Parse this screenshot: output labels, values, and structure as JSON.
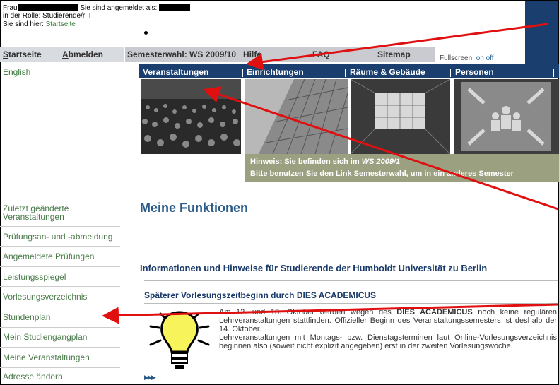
{
  "login": {
    "frau": "Frau",
    "logged_in_as": "Sie sind angemeldet als:",
    "role": "in der Rolle: Studierende/r",
    "role_suffix": "I",
    "breadcrumb_label": "Sie sind hier:",
    "breadcrumb_link": "Startseite"
  },
  "topnav": {
    "start": "Startseite",
    "logout": "Abmelden",
    "semester": "Semesterwahl: WS 2009/10",
    "help": "Hilfe",
    "faq": "FAQ",
    "sitemap": "Sitemap",
    "fullscreen_label": "Fullscreen:",
    "fullscreen_on": "on",
    "fullscreen_off": "off"
  },
  "sidebar": {
    "language": "English",
    "items": [
      {
        "label": "Zuletzt geänderte Veranstaltungen"
      },
      {
        "label": "Prüfungsan- und -abmeldung"
      },
      {
        "label": "Angemeldete Prüfungen"
      },
      {
        "label": "Leistungsspiegel"
      },
      {
        "label": "Vorlesungsverzeichnis"
      },
      {
        "label": "Stundenplan"
      },
      {
        "label": "Mein Studiengangplan"
      },
      {
        "label": "Meine Veranstaltungen"
      },
      {
        "label": "Adresse ändern"
      }
    ]
  },
  "categories": [
    {
      "label": "Veranstaltungen"
    },
    {
      "label": "Einrichtungen"
    },
    {
      "label": "Räume & Gebäude"
    },
    {
      "label": "Personen"
    }
  ],
  "hint": {
    "line1_prefix": "Hinweis: Sie befinden sich im",
    "line1_semester": "WS 2009/1",
    "line2": "Bitte benutzen Sie den Link Semesterwahl, um in ein anderes Semester"
  },
  "main": {
    "functions_title": "Meine Funktionen",
    "info_title": "Informationen und Hinweise für Studierende der Humboldt Universität zu Berlin",
    "news_title": "Späterer Vorlesungszeitbeginn durch DIES ACADEMICUS",
    "news_p1_a": "Am 12. und 13. Oktober werden wegen des",
    "news_p1_bold": "DIES ACADEMICUS",
    "news_p1_b": "noch keine regulären Lehrveranstaltungen stattfinden. Offizieller Beginn des Veranstaltungssemesters ist deshalb der 14. Oktober.",
    "news_p2": "Lehrveranstaltungen mit Montags- bzw. Dienstagsterminen laut Online-Vorlesungsverzeichnis beginnen also (soweit nicht explizit angegeben) erst in der zweiten Vorlesungswoche.",
    "more_icon": "triple-chevron-icon"
  },
  "colors": {
    "nav_blue": "#1a3e6e",
    "link_green": "#3a7a3a",
    "title_blue": "#2a5a8a",
    "hint_bg": "#9aa080",
    "arrow_red": "#e01010"
  }
}
